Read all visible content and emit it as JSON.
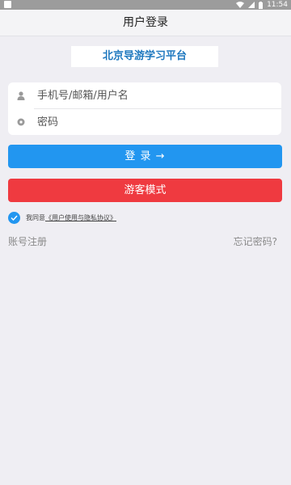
{
  "status_bar": {
    "time": "11:54",
    "icons": [
      "app-notification-icon",
      "wifi-icon",
      "signal-icon",
      "battery-icon"
    ]
  },
  "header": {
    "title": "用户登录"
  },
  "brand": {
    "name": "北京导游学习平台"
  },
  "login_form": {
    "username_placeholder": "手机号/邮箱/用户名",
    "username_value": "",
    "password_placeholder": "密码",
    "password_value": ""
  },
  "buttons": {
    "login_label": "登 录 →",
    "guest_label": "游客模式"
  },
  "agreement": {
    "checked": true,
    "prefix": "我同意",
    "link_text": "《用户使用与隐私协议》"
  },
  "links": {
    "register": "账号注册",
    "forgot_password": "忘记密码?"
  },
  "colors": {
    "primary": "#2296f0",
    "danger": "#ef3a40",
    "brand_text": "#1e78bf",
    "background": "#efeef3"
  }
}
